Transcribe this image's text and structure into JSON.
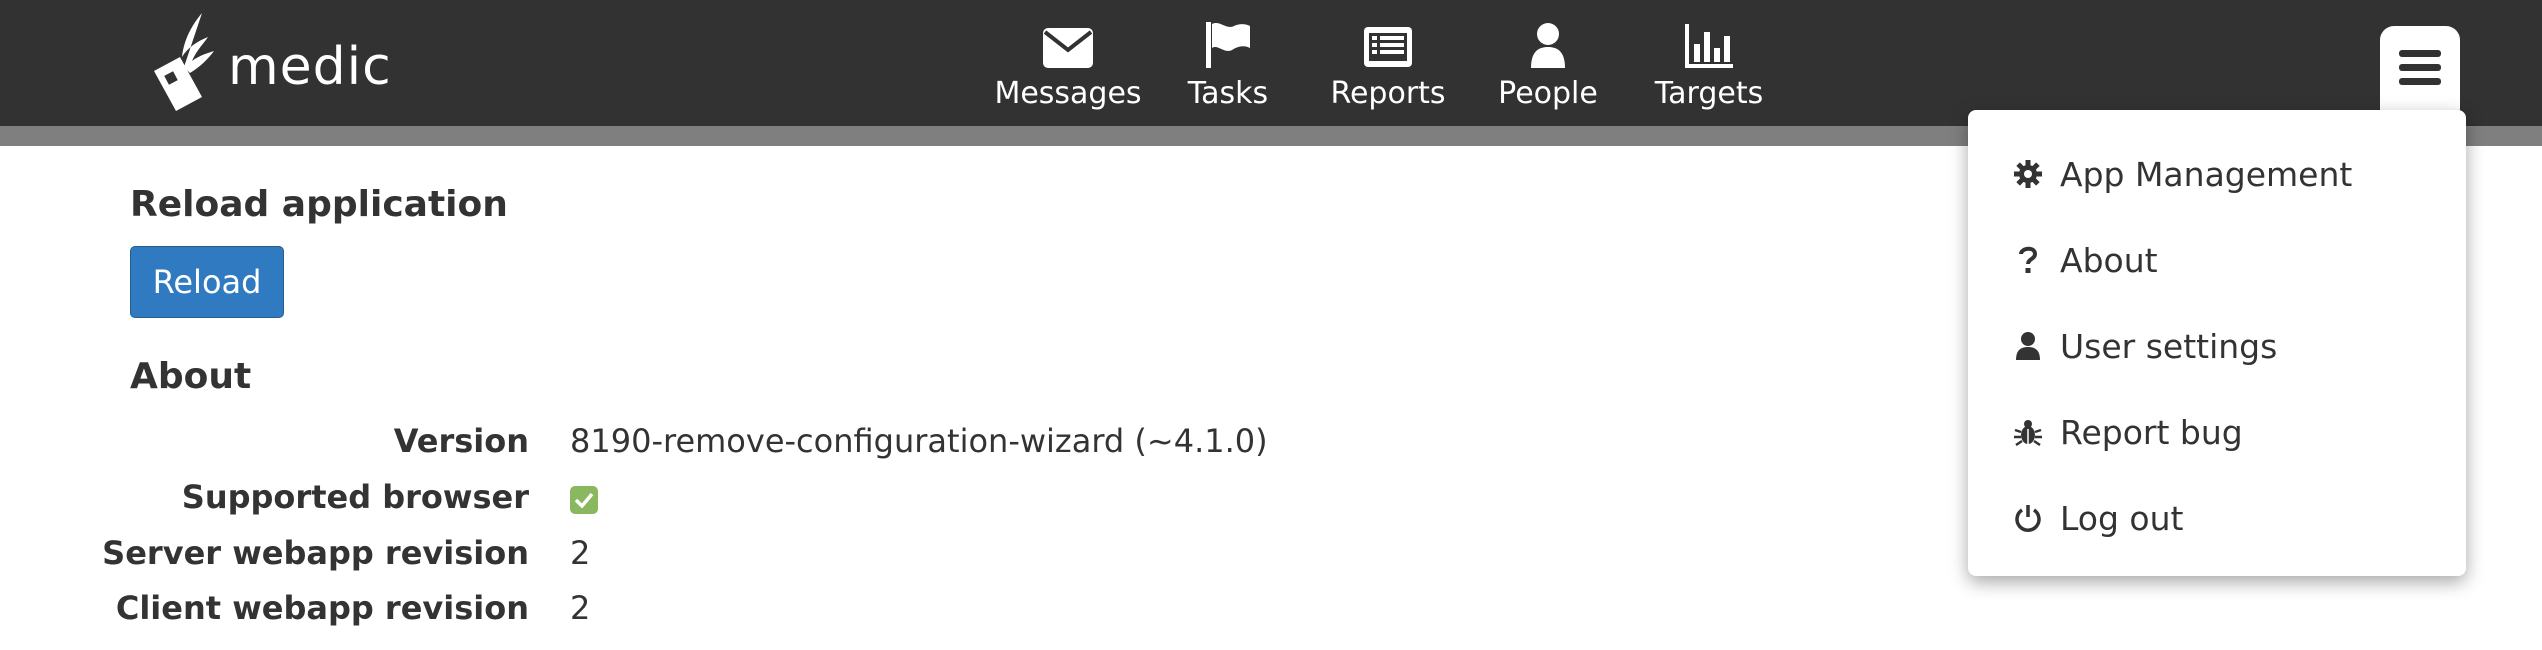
{
  "header": {
    "brand": "medic",
    "tabs": [
      {
        "label": "Messages",
        "icon": "envelope-icon"
      },
      {
        "label": "Tasks",
        "icon": "flag-icon"
      },
      {
        "label": "Reports",
        "icon": "list-alt-icon"
      },
      {
        "label": "People",
        "icon": "user-icon"
      },
      {
        "label": "Targets",
        "icon": "bar-chart-icon"
      }
    ],
    "menu_icon": "hamburger-icon"
  },
  "dropdown": {
    "items": [
      {
        "label": "App Management",
        "icon": "gear-icon"
      },
      {
        "label": "About",
        "icon": "question-icon"
      },
      {
        "label": "User settings",
        "icon": "user-icon"
      },
      {
        "label": "Report bug",
        "icon": "bug-icon"
      },
      {
        "label": "Log out",
        "icon": "power-icon"
      }
    ]
  },
  "main": {
    "reload_title": "Reload application",
    "reload_button": "Reload",
    "about_title": "About",
    "rows": [
      {
        "label": "Version",
        "value": "8190-remove-configuration-wizard (~4.1.0)"
      },
      {
        "label": "Supported browser",
        "value": "",
        "icon": "check-square-icon"
      },
      {
        "label": "Server webapp revision",
        "value": "2"
      },
      {
        "label": "Client webapp revision",
        "value": "2"
      }
    ]
  },
  "colors": {
    "header_bg": "#323232",
    "stripe": "#7f7f7f",
    "primary_button": "#2f7ac0",
    "success": "#8ab85e"
  }
}
